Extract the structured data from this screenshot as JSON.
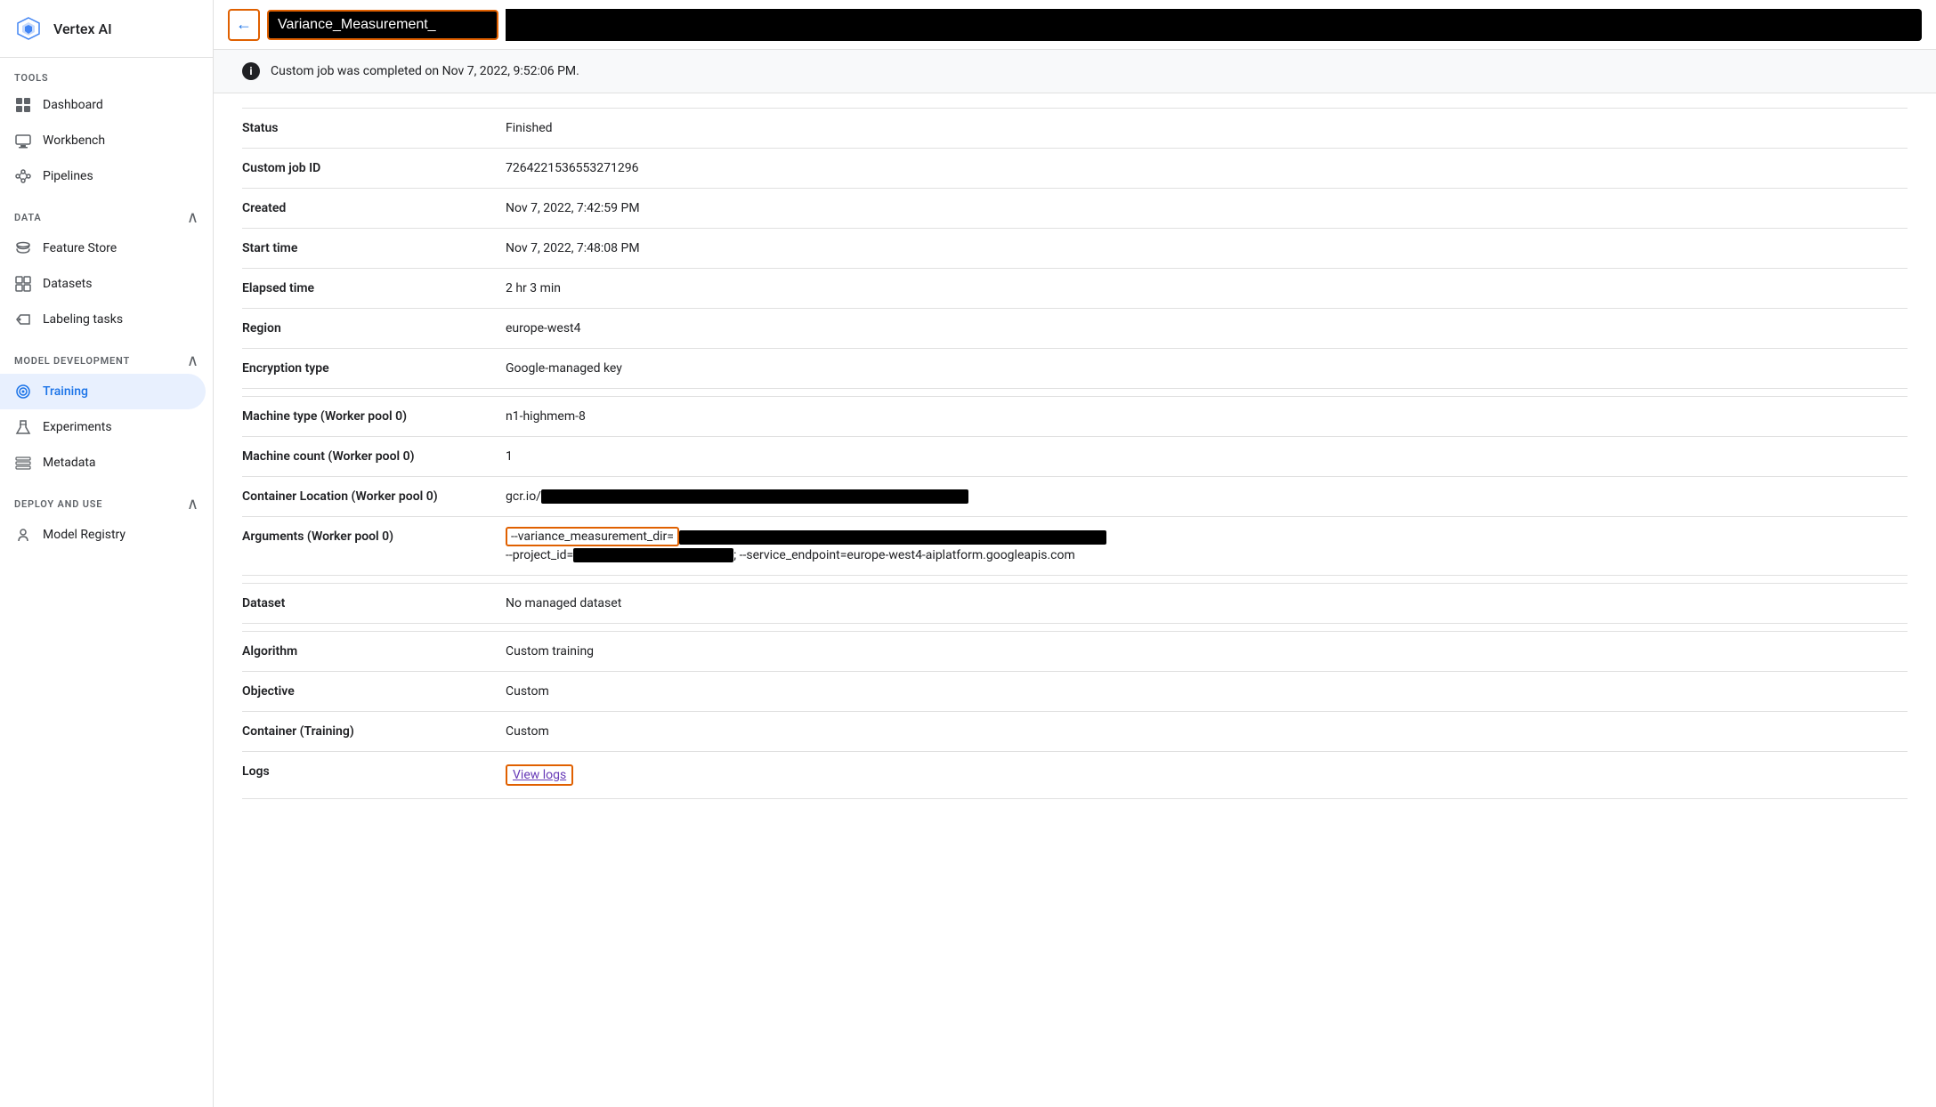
{
  "app": {
    "title": "Vertex AI",
    "logo_symbol": "⬡"
  },
  "sidebar": {
    "tools_label": "TOOLS",
    "items_tools": [
      {
        "id": "dashboard",
        "label": "Dashboard",
        "icon": "▦"
      },
      {
        "id": "workbench",
        "label": "Workbench",
        "icon": "⊡"
      },
      {
        "id": "pipelines",
        "label": "Pipelines",
        "icon": "⑂"
      }
    ],
    "data_label": "DATA",
    "data_chevron": "∧",
    "items_data": [
      {
        "id": "feature-store",
        "label": "Feature Store",
        "icon": "⊕"
      },
      {
        "id": "datasets",
        "label": "Datasets",
        "icon": "⊞"
      },
      {
        "id": "labeling-tasks",
        "label": "Labeling tasks",
        "icon": "◈"
      }
    ],
    "model_dev_label": "MODEL DEVELOPMENT",
    "model_dev_chevron": "∧",
    "items_model_dev": [
      {
        "id": "training",
        "label": "Training",
        "icon": "◎",
        "active": true
      },
      {
        "id": "experiments",
        "label": "Experiments",
        "icon": "⚗"
      },
      {
        "id": "metadata",
        "label": "Metadata",
        "icon": "⊟"
      }
    ],
    "deploy_label": "DEPLOY AND USE",
    "deploy_chevron": "∧",
    "items_deploy": [
      {
        "id": "model-registry",
        "label": "Model Registry",
        "icon": "💡"
      }
    ]
  },
  "topbar": {
    "back_label": "←",
    "title": "Variance_Measurement_"
  },
  "banner": {
    "message": "Custom job was completed on Nov 7, 2022, 9:52:06 PM."
  },
  "details": [
    {
      "label": "Status",
      "value": "Finished",
      "type": "text"
    },
    {
      "label": "Custom job ID",
      "value": "7264221536553271296",
      "type": "text"
    },
    {
      "label": "Created",
      "value": "Nov 7, 2022, 7:42:59 PM",
      "type": "text"
    },
    {
      "label": "Start time",
      "value": "Nov 7, 2022, 7:48:08 PM",
      "type": "text"
    },
    {
      "label": "Elapsed time",
      "value": "2 hr 3 min",
      "type": "text"
    },
    {
      "label": "Region",
      "value": "europe-west4",
      "type": "text"
    },
    {
      "label": "Encryption type",
      "value": "Google-managed key",
      "type": "text"
    },
    {
      "label": "SPACER",
      "value": "",
      "type": "spacer"
    },
    {
      "label": "Machine type (Worker pool 0)",
      "value": "n1-highmem-8",
      "type": "text"
    },
    {
      "label": "Machine count (Worker pool 0)",
      "value": "1",
      "type": "text"
    },
    {
      "label": "Container Location (Worker pool 0)",
      "value": "gcr.io/",
      "type": "redacted"
    },
    {
      "label": "Arguments (Worker pool 0)",
      "value": "--variance_measurement_dir=",
      "value2": "--project_id=",
      "value3": "; --service_endpoint=europe-west4-aiplatform.googleapis.com",
      "type": "args"
    },
    {
      "label": "SPACER",
      "value": "",
      "type": "spacer"
    },
    {
      "label": "Dataset",
      "value": "No managed dataset",
      "type": "text"
    },
    {
      "label": "SPACER",
      "value": "",
      "type": "spacer"
    },
    {
      "label": "Algorithm",
      "value": "Custom training",
      "type": "text"
    },
    {
      "label": "Objective",
      "value": "Custom",
      "type": "text"
    },
    {
      "label": "Container (Training)",
      "value": "Custom",
      "type": "text"
    },
    {
      "label": "Logs",
      "value": "View logs",
      "type": "link"
    }
  ]
}
